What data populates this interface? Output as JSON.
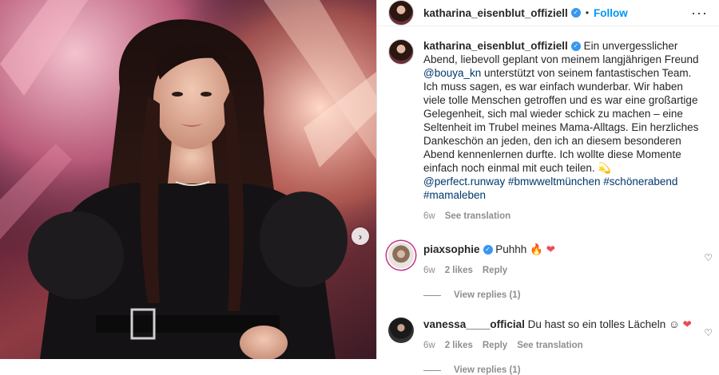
{
  "post": {
    "author": "katharina_eisenblut_offiziell",
    "follow_label": "Follow",
    "separator": "•",
    "more_icon": "more-horizontal-icon"
  },
  "caption": {
    "username": "katharina_eisenblut_offiziell",
    "text_1": " Ein unvergesslicher Abend, liebevoll geplant von meinem langjährigen Freund ",
    "mention": "@bouya_kn",
    "text_2": " unterstützt von seinem fantastischen Team. Ich muss sagen, es war einfach wunderbar. Wir haben viele tolle Menschen getroffen und es war eine großartige Gelegenheit, sich mal wieder schick zu machen – eine Seltenheit im Trubel meines Mama-Alltags. Ein herzliches Dankeschön an jeden, den ich an diesem besonderen Abend kennenlernen durfte. Ich wollte diese Momente einfach noch einmal mit euch teilen. 💫",
    "hashtags": "@perfect.runway #bmwweltmünchen #schönerabend #mamaleben",
    "age": "6w",
    "see_translation": "See translation"
  },
  "comments": [
    {
      "username": "piaxsophie",
      "text": " Puhhh 🔥",
      "heart": "❤",
      "age": "6w",
      "likes": "2 likes",
      "reply": "Reply",
      "view_replies": "View replies (1)"
    },
    {
      "username": "vanessa____official",
      "text": " Du hast so ein tolles Lächeln ☺",
      "heart": "❤",
      "age": "6w",
      "likes": "2 likes",
      "reply": "Reply",
      "see_translation": "See translation",
      "view_replies": "View replies (1)"
    }
  ],
  "icons": {
    "verified": "✓",
    "like": "♡",
    "next": "›"
  },
  "colors": {
    "link_blue": "#0095f6",
    "mention_blue": "#00376b",
    "muted": "#8e8e8e",
    "verified": "#3897f0"
  }
}
